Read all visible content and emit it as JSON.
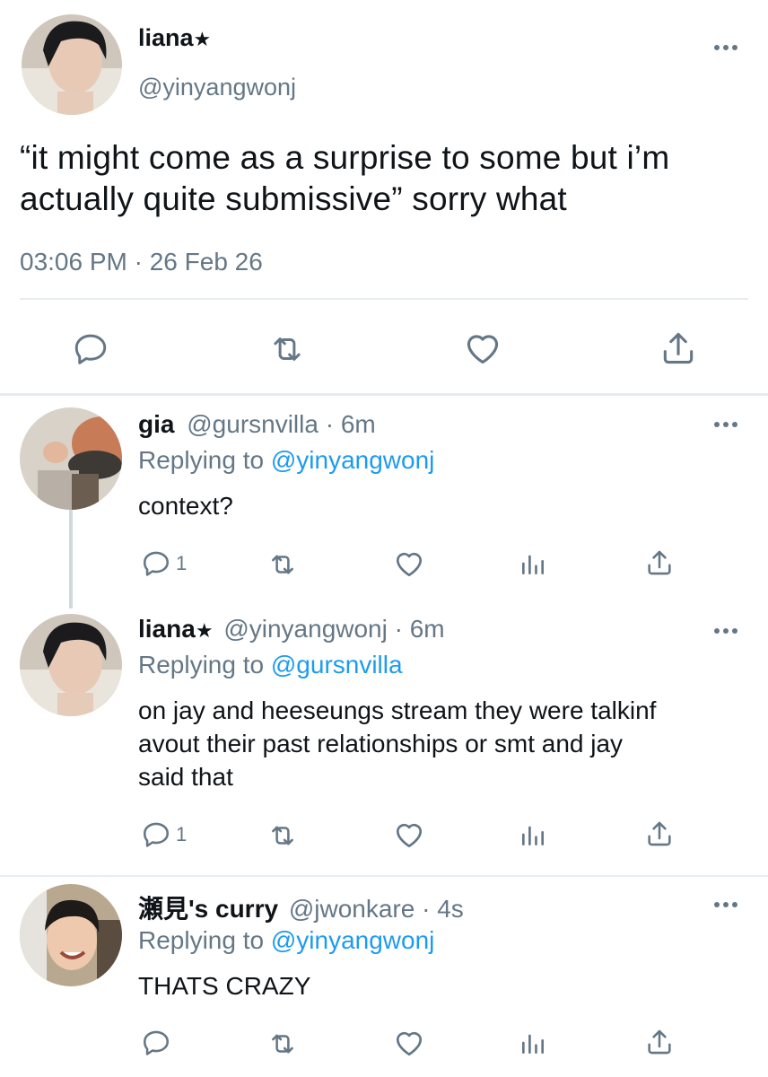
{
  "main_tweet": {
    "display_name": "liana",
    "badge": "★",
    "handle": "@yinyangwonj",
    "text_line1": "“it might come as a surprise to some but i’m",
    "text_line2": "actually quite submissive” sorry what",
    "timestamp": "03:06 PM · 26 Feb 26",
    "icons": [
      "reply-icon",
      "retweet-icon",
      "like-icon",
      "share-icon"
    ]
  },
  "replies": [
    {
      "display_name": "gia",
      "handle_time": "@gursnvilla · 6m",
      "replying_label": "Replying to",
      "replying_to": "@yinyangwonj",
      "lines": [
        "context?"
      ],
      "reply_count": "1"
    },
    {
      "display_name": "liana",
      "badge": "★",
      "handle_time": "@yinyangwonj · 6m",
      "replying_label": "Replying to",
      "replying_to": "@gursnvilla",
      "lines": [
        "on jay and heeseungs stream they were talkinf",
        "avout their past relationships or smt and jay",
        "said that"
      ],
      "reply_count": "1"
    },
    {
      "display_name": "瀬見's curry",
      "handle_time": "@jwonkare · 4s",
      "replying_label": "Replying to",
      "replying_to": "@yinyangwonj",
      "lines": [
        "THATS CRAZY"
      ],
      "reply_count": ""
    }
  ],
  "colors": {
    "text": "#0f1419",
    "secondary": "#657786",
    "link": "#1d9bf0",
    "divider": "#e6ecf0",
    "thread_line": "#cfd9de"
  }
}
